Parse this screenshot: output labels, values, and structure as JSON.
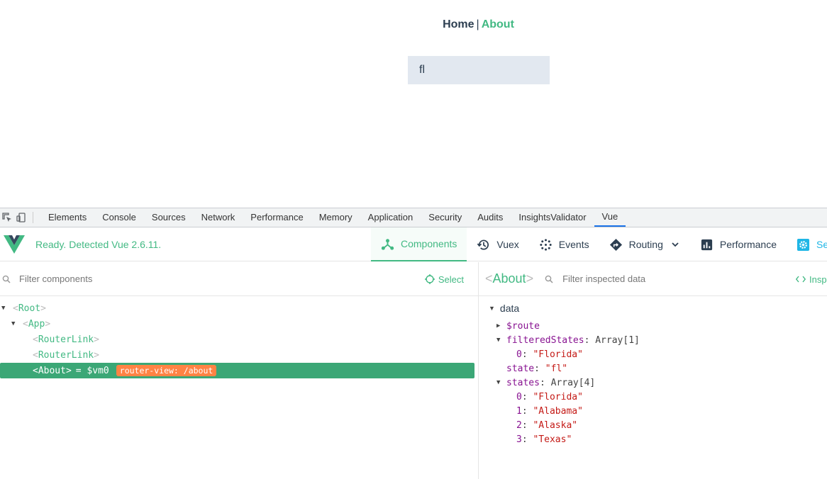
{
  "app": {
    "nav": {
      "home": "Home",
      "separator": "|",
      "about": "About"
    },
    "search_value": "fl"
  },
  "devtools_tabs": [
    {
      "label": "Elements"
    },
    {
      "label": "Console"
    },
    {
      "label": "Sources"
    },
    {
      "label": "Network"
    },
    {
      "label": "Performance"
    },
    {
      "label": "Memory"
    },
    {
      "label": "Application"
    },
    {
      "label": "Security"
    },
    {
      "label": "Audits"
    },
    {
      "label": "InsightsValidator"
    },
    {
      "label": "Vue",
      "active": true
    }
  ],
  "vue": {
    "status": "Ready. Detected Vue 2.6.11.",
    "tabs": [
      {
        "label": "Components",
        "icon": "components-icon",
        "active": true
      },
      {
        "label": "Vuex",
        "icon": "history-icon"
      },
      {
        "label": "Events",
        "icon": "events-icon"
      },
      {
        "label": "Routing",
        "icon": "routing-icon"
      },
      {
        "label": "Performance",
        "icon": "bar-chart-icon"
      },
      {
        "label": "Se",
        "icon": "settings-icon"
      }
    ]
  },
  "left_pane": {
    "filter_placeholder": "Filter components",
    "select_label": "Select",
    "tree": {
      "root": "Root",
      "app": "App",
      "link1": "RouterLink",
      "link2": "RouterLink",
      "about": "About",
      "about_suffix": "= $vm0",
      "badge": "router-view: /about"
    }
  },
  "right_pane": {
    "component_name": "About",
    "filter_placeholder": "Filter inspected data",
    "inspect_label": "Insp",
    "section_title": "data",
    "route_key": "$route",
    "filtered_key": "filteredStates",
    "filtered_type": "Array[1]",
    "filtered_items": [
      {
        "idx": "0",
        "val": "\"Florida\""
      }
    ],
    "state_key": "state",
    "state_val": "\"fl\"",
    "states_key": "states",
    "states_type": "Array[4]",
    "states_items": [
      {
        "idx": "0",
        "val": "\"Florida\""
      },
      {
        "idx": "1",
        "val": "\"Alabama\""
      },
      {
        "idx": "2",
        "val": "\"Alaska\""
      },
      {
        "idx": "3",
        "val": "\"Texas\""
      }
    ]
  },
  "colors": {
    "vue_green": "#42b983",
    "selected_row": "#3ba776",
    "badge": "#ff8344",
    "input_bg": "#e2e8f0"
  }
}
